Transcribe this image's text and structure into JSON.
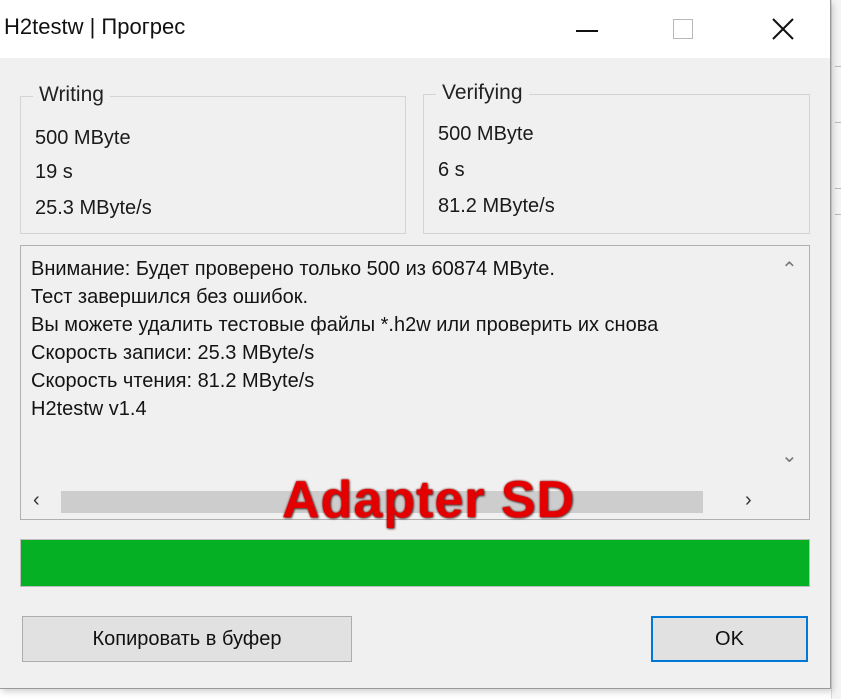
{
  "window": {
    "title": "H2testw | Прогрес",
    "controls": {
      "minimize": "minimize-icon",
      "maximize": "maximize-icon",
      "close": "close-icon"
    }
  },
  "writing": {
    "legend": "Writing",
    "size": "500 MByte",
    "time": "19 s",
    "speed": "25.3 MByte/s"
  },
  "verifying": {
    "legend": "Verifying",
    "size": "500 MByte",
    "time": "6 s",
    "speed": "81.2 MByte/s"
  },
  "log": {
    "lines": [
      "Внимание: Будет проверено только 500 из 60874 MByte.",
      "Тест завершился без ошибок.",
      "Вы можете удалить тестовые файлы *.h2w или проверить их снова",
      "Скорость записи: 25.3 MByte/s",
      "Скорость чтения: 81.2 MByte/s",
      "H2testw v1.4"
    ]
  },
  "watermark": "Adapter SD",
  "progress": {
    "value": 1.0,
    "color": "#06b025"
  },
  "buttons": {
    "copy": "Копировать в буфер",
    "ok": "OK"
  },
  "colors": {
    "accent": "#0078d7",
    "watermark": "#e40000"
  }
}
